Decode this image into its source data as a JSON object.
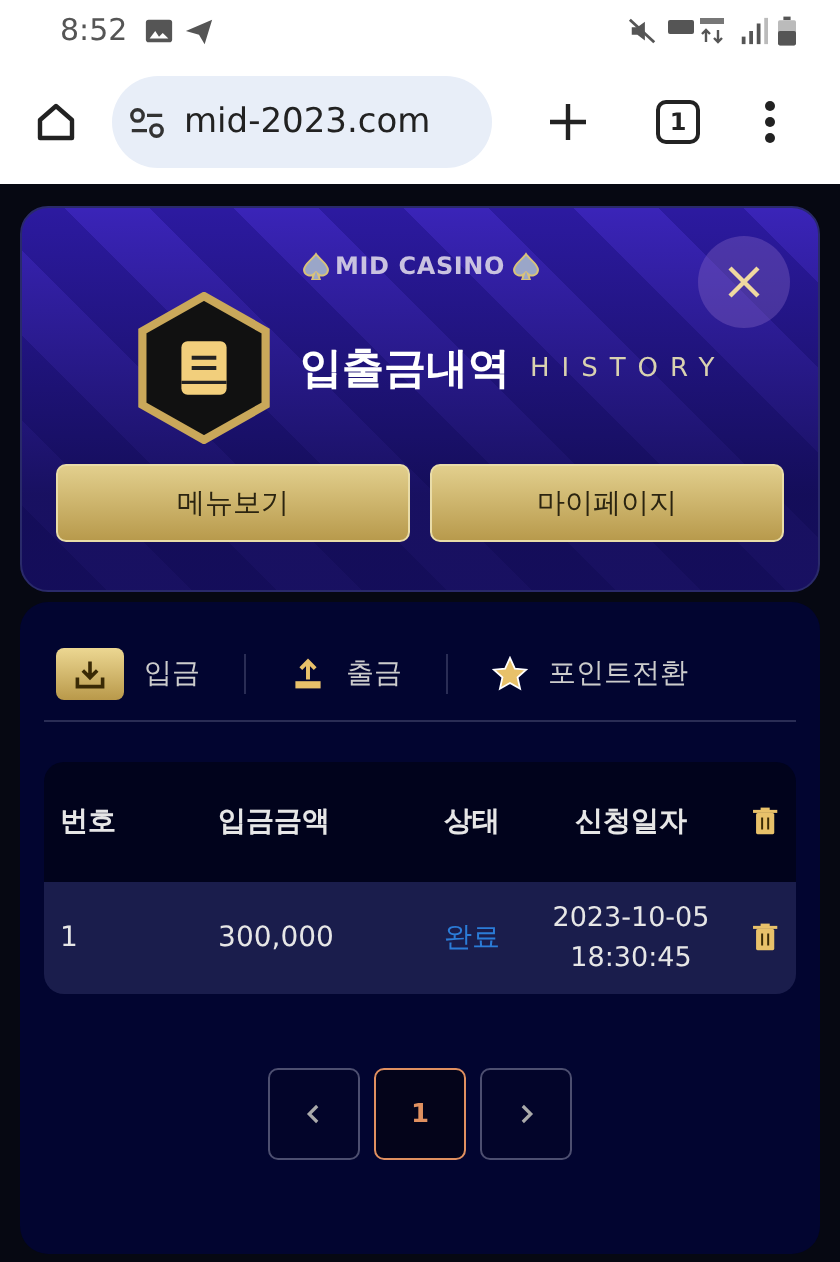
{
  "status_bar": {
    "time": "8:52"
  },
  "browser": {
    "url": "mid-2023.com",
    "tab_count": "1"
  },
  "header": {
    "brand": "MID CASINO",
    "title": "입출금내역",
    "subtitle": "HISTORY",
    "buttons": [
      "메뉴보기",
      "마이페이지"
    ]
  },
  "tabs": [
    {
      "label": "입금",
      "kind": "deposit",
      "selected": true
    },
    {
      "label": "출금",
      "kind": "withdraw",
      "selected": false
    },
    {
      "label": "포인트전환",
      "kind": "points",
      "selected": false
    }
  ],
  "table": {
    "columns": [
      "번호",
      "입금금액",
      "상태",
      "신청일자"
    ],
    "rows": [
      {
        "number": "1",
        "amount": "300,000",
        "status": "완료",
        "date": "2023-10-05",
        "time": "18:30:45"
      }
    ]
  },
  "pagination": {
    "pages": [
      {
        "label": "1",
        "selected": true
      }
    ]
  }
}
